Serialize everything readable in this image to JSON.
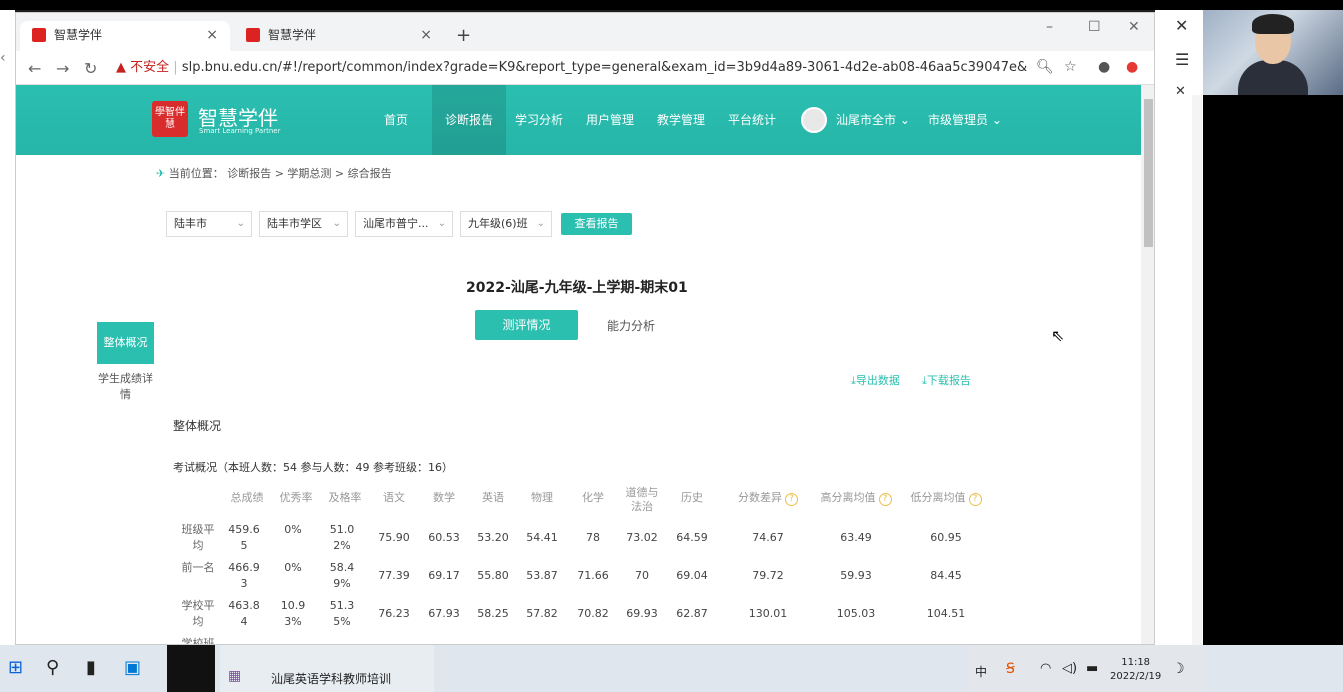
{
  "browser": {
    "tabs": [
      {
        "title": "智慧学伴",
        "close": "×"
      },
      {
        "title": "智慧学伴",
        "close": "×"
      }
    ],
    "new_tab": "+",
    "window_controls": {
      "minimize": "–",
      "maximize": "☐",
      "close": "✕"
    },
    "nav": {
      "back": "←",
      "forward": "→",
      "reload": "↻"
    },
    "security_label": "不安全",
    "url": "slp.bnu.edu.cn/#!/report/common/index?grade=K9&report_type=general&exam_id=3b9d4a89-3061-4d2e-ab08-46aa5c39047e&exam_..."
  },
  "outer": {
    "close1": "✕",
    "close2": "✕",
    "menu": "☰"
  },
  "site": {
    "logo_mark": "學智伴慧",
    "logo_text": "智慧学伴",
    "logo_sub": "Smart Learning Partner",
    "nav": [
      "首页",
      "诊断报告",
      "学习分析",
      "用户管理",
      "教学管理",
      "平台统计"
    ],
    "user_region": "汕尾市全市",
    "user_role": "市级管理员"
  },
  "breadcrumb": "当前位置： 诊断报告 > 学期总测 > 综合报告",
  "filters": [
    "陆丰市",
    "陆丰市学区",
    "汕尾市普宁...",
    "九年级(6)班"
  ],
  "view_report_label": "查看报告",
  "exam_title": "2022-汕尾-九年级-上学期-期末01",
  "tabs": {
    "eval": "测评情况",
    "ability": "能力分析"
  },
  "sidebar": {
    "overall": "整体概况",
    "detail": "学生成绩详情"
  },
  "tools": {
    "export": "导出数据",
    "download": "下载报告"
  },
  "section_title": "整体概况",
  "summary": "考试概况（本班人数：54   参与人数：49   参考班级：16）",
  "table": {
    "headers": [
      "总成绩",
      "优秀率",
      "及格率",
      "语文",
      "数学",
      "英语",
      "物理",
      "化学",
      "道德与法治",
      "历史",
      "分数差异",
      "高分离均值",
      "低分离均值"
    ],
    "rows": [
      {
        "label": "班级平均",
        "values": [
          "459.65",
          "0%",
          "51.02%",
          "75.90",
          "60.53",
          "53.20",
          "54.41",
          "78",
          "73.02",
          "64.59",
          "74.67",
          "63.49",
          "60.95"
        ]
      },
      {
        "label": "前一名",
        "values": [
          "466.93",
          "0%",
          "58.49%",
          "77.39",
          "69.17",
          "55.80",
          "53.87",
          "71.66",
          "70",
          "69.04",
          "79.72",
          "59.93",
          "84.45"
        ]
      },
      {
        "label": "学校平均",
        "values": [
          "463.84",
          "10.93%",
          "51.35%",
          "76.23",
          "67.93",
          "58.25",
          "57.82",
          "70.82",
          "69.93",
          "62.87",
          "130.01",
          "105.03",
          "104.51"
        ]
      }
    ],
    "partial_row_label": "学校班"
  },
  "taskbar": {
    "window_title": "汕尾英语学科教师培训",
    "time": "11:18",
    "date": "2022/2/19",
    "ime": "中"
  }
}
